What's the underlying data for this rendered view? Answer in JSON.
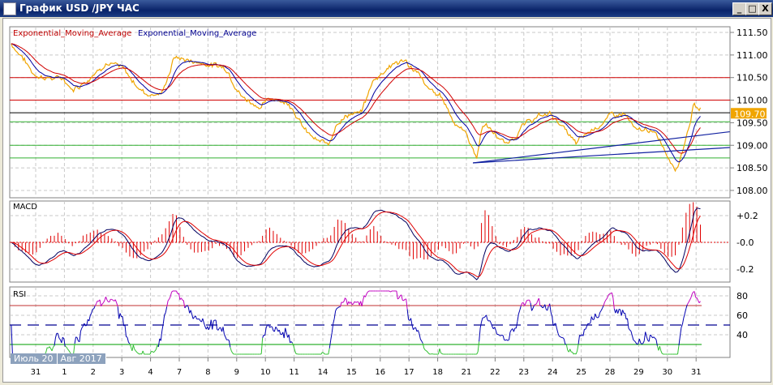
{
  "window": {
    "title": "График USD /JPY  ЧАС",
    "minimize": "_",
    "maximize": "□",
    "close": "X"
  },
  "legend": {
    "ema1": "Exponential_Moving_Average",
    "ema2": "Exponential_Moving_Average"
  },
  "colors": {
    "price": "#f0a500",
    "ema_red": "#d00000",
    "ema_blue": "#0000a0",
    "macd": "#000060",
    "signal": "#e00000",
    "rsi": "#0000b0",
    "rsi_over": "#c000c0",
    "rsi_under": "#30c030",
    "green_line": "#30b030",
    "red_line": "#d00000"
  },
  "chart_data": {
    "type": "line",
    "title": "График USD /JPY  ЧАС",
    "price_axis": {
      "ticks": [
        "111.50",
        "111.00",
        "110.50",
        "110.00",
        "109.50",
        "109.00",
        "108.50",
        "108.00"
      ],
      "values": [
        111.5,
        111.0,
        110.5,
        110.0,
        109.5,
        109.0,
        108.5,
        108.0
      ]
    },
    "current_price": "109.70",
    "x_ticks": [
      "31",
      "1",
      "2",
      "3",
      "4",
      "7",
      "8",
      "9",
      "10",
      "11",
      "14",
      "15",
      "16",
      "17",
      "18",
      "21",
      "22",
      "23",
      "24",
      "25",
      "28",
      "29",
      "30",
      "31"
    ],
    "period_labels": [
      "Июль 20",
      "Авг 2017"
    ],
    "price_points": [
      [
        -0.85,
        111.25
      ],
      [
        -0.5,
        111.0
      ],
      [
        -0.11,
        110.6
      ],
      [
        0.45,
        110.5
      ],
      [
        1.0,
        110.45
      ],
      [
        1.3,
        110.25
      ],
      [
        1.86,
        110.5
      ],
      [
        2.43,
        110.87
      ],
      [
        2.99,
        110.7
      ],
      [
        3.4,
        110.4
      ],
      [
        3.84,
        110.15
      ],
      [
        4.41,
        110.15
      ],
      [
        4.83,
        110.96
      ],
      [
        5.4,
        110.87
      ],
      [
        6.1,
        110.8
      ],
      [
        6.67,
        110.7
      ],
      [
        7.23,
        110.06
      ],
      [
        7.8,
        109.88
      ],
      [
        8.36,
        110.06
      ],
      [
        8.93,
        109.9
      ],
      [
        9.35,
        109.35
      ],
      [
        9.77,
        109.08
      ],
      [
        10.2,
        109.0
      ],
      [
        10.48,
        109.53
      ],
      [
        10.9,
        109.7
      ],
      [
        11.33,
        109.7
      ],
      [
        11.75,
        110.42
      ],
      [
        12.32,
        110.78
      ],
      [
        12.88,
        110.87
      ],
      [
        13.3,
        110.6
      ],
      [
        13.59,
        110.25
      ],
      [
        14.15,
        110.06
      ],
      [
        14.58,
        109.53
      ],
      [
        15.0,
        109.26
      ],
      [
        15.37,
        108.72
      ],
      [
        15.56,
        109.5
      ],
      [
        15.99,
        109.26
      ],
      [
        16.41,
        109.0
      ],
      [
        16.84,
        109.35
      ],
      [
        17.4,
        109.61
      ],
      [
        17.97,
        109.7
      ],
      [
        18.53,
        109.26
      ],
      [
        18.81,
        109.0
      ],
      [
        19.38,
        109.35
      ],
      [
        19.94,
        109.61
      ],
      [
        20.51,
        109.7
      ],
      [
        20.93,
        109.26
      ],
      [
        21.36,
        109.35
      ],
      [
        21.78,
        109.08
      ],
      [
        22.06,
        108.72
      ],
      [
        22.34,
        108.54
      ],
      [
        22.63,
        109.15
      ],
      [
        22.91,
        109.88
      ],
      [
        23.19,
        109.75
      ]
    ],
    "horizontal_lines": [
      {
        "price": 110.5,
        "color": "red"
      },
      {
        "price": 110.0,
        "color": "red"
      },
      {
        "price": 109.72,
        "color": "black"
      },
      {
        "price": 109.52,
        "color": "green"
      },
      {
        "price": 109.0,
        "color": "green"
      },
      {
        "price": 108.72,
        "color": "green"
      }
    ],
    "trend_lines": [
      {
        "from": [
          15.23,
          108.61
        ],
        "to": [
          24.17,
          109.3
        ]
      },
      {
        "from": [
          15.23,
          108.61
        ],
        "to": [
          24.17,
          108.95
        ]
      }
    ],
    "macd": {
      "label": "MACD",
      "ticks": [
        "+0.2",
        "-0.0",
        "-0.2"
      ],
      "values": [
        0.2,
        0,
        -0.2
      ]
    },
    "rsi": {
      "label": "RSI",
      "ticks": [
        "80",
        "60",
        "40"
      ],
      "values": [
        80,
        60,
        40
      ],
      "levels": [
        70,
        50,
        30
      ]
    }
  }
}
